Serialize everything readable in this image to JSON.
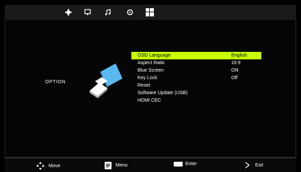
{
  "header": {
    "tabs": [
      {
        "icon": "gear-icon"
      },
      {
        "icon": "monitor-icon"
      },
      {
        "icon": "music-note-icon"
      },
      {
        "icon": "clock-icon"
      },
      {
        "icon": "option-grid-icon"
      }
    ]
  },
  "sidebar": {
    "title": "OPTION",
    "logo_icon": "option-logo-icon"
  },
  "menu": {
    "items": [
      {
        "label": "OSD Language",
        "value": "English",
        "selected": true
      },
      {
        "label": "Aspect Ratio",
        "value": "16:9"
      },
      {
        "label": "Blue Screen",
        "value": "ON"
      },
      {
        "label": "Key Lock",
        "value": "Off"
      },
      {
        "label": "Reset",
        "value": ""
      },
      {
        "label": "Software Update (USB)",
        "value": ""
      },
      {
        "label": "HDMI CEC",
        "value": ""
      }
    ]
  },
  "footer": {
    "move_label": "Move",
    "menu_label": "Menu",
    "enter_label": "Enter",
    "exit_label": "Exit"
  },
  "colors": {
    "highlight": "#c8ff00",
    "logo_blue": "#5ab8f0"
  }
}
